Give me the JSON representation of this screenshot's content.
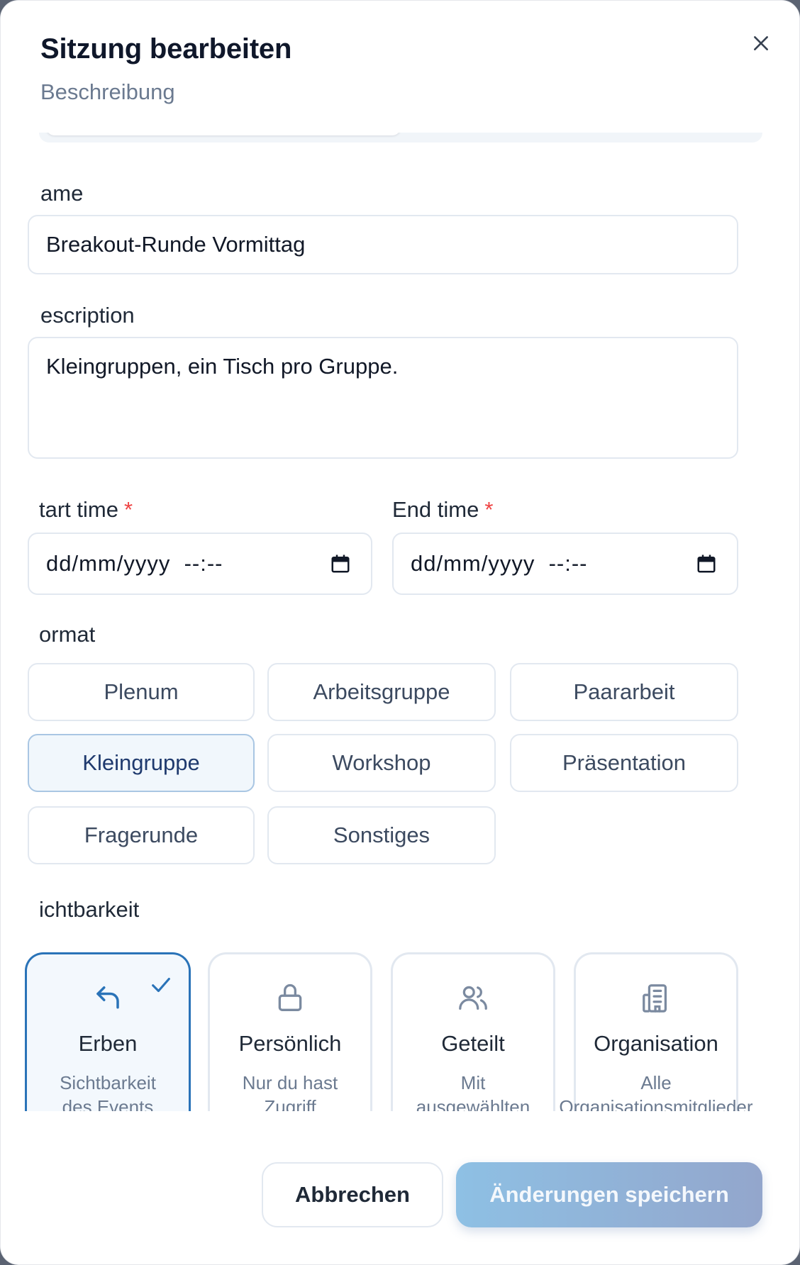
{
  "dialog": {
    "title": "Sitzung bearbeiten",
    "subtitle": "Beschreibung"
  },
  "form": {
    "name_label": "ame",
    "name_value": "Breakout-Runde Vormittag",
    "description_label": "escription",
    "description_value": "Kleingruppen, ein Tisch pro Gruppe.",
    "start_label": "tart time",
    "end_label": "End time",
    "required_mark": "*",
    "start_value": "dd/mm/yyyy  --:--",
    "end_value": "dd/mm/yyyy  --:--",
    "format_label": "ormat",
    "formats": [
      "Plenum",
      "Arbeitsgruppe",
      "Paararbeit",
      "Kleingruppe",
      "Workshop",
      "Präsentation",
      "Fragerunde",
      "Sonstiges"
    ],
    "selected_format": "Kleingruppe",
    "visibility_label": "ichtbarkeit",
    "visibility": [
      {
        "title": "Erben",
        "desc": "Sichtbarkeit des Events",
        "icon": "inherit-icon",
        "selected": true
      },
      {
        "title": "Persönlich",
        "desc": "Nur du hast Zugriff",
        "icon": "lock-icon",
        "selected": false
      },
      {
        "title": "Geteilt",
        "desc": "Mit ausgewählten",
        "icon": "users-icon",
        "selected": false
      },
      {
        "title": "Organisation",
        "desc": "Alle Organisationsmitglieder",
        "icon": "building-icon",
        "selected": false
      }
    ]
  },
  "footer": {
    "cancel_label": "Abbrechen",
    "save_label": "Änderungen speichern"
  },
  "colors": {
    "accent": "#2a73b8",
    "required": "#ef4444",
    "save_gradient_start": "#8ec0e4",
    "save_gradient_end": "#93a6cc"
  }
}
